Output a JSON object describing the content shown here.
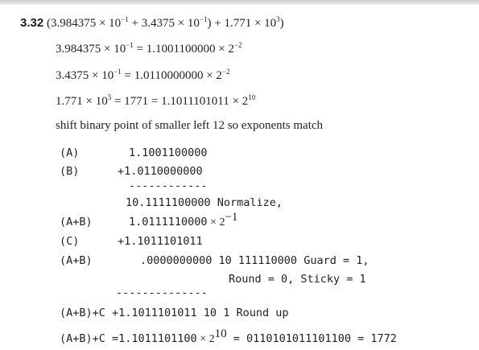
{
  "problem": {
    "number": "3.32",
    "expr": "(3.984375 × 10",
    "expr_e1": "−1",
    "expr_mid": " + 3.4375 × 10",
    "expr_e2": "−1",
    "expr_mid2": ") + 1.771 × 10",
    "expr_e3": "3",
    "expr_end": ")"
  },
  "conversions": [
    {
      "a": "3.984375 × 10",
      "ae": "−1",
      "b": " = 1.1001100000 × 2",
      "be": "−2"
    },
    {
      "a": "3.4375 × 10",
      "ae": "−1",
      "b": " = 1.0110000000 × 2",
      "be": "−2"
    },
    {
      "a": "1.771 × 10",
      "ae": "3",
      "b": " = 1771 = 1.1011101011 × 2",
      "be": "10"
    }
  ],
  "shift_note": "shift binary point of smaller left 12 so exponents match",
  "work": {
    "a_label": "(A)",
    "a_value": "1.1001100000",
    "b_label": "(B)",
    "b_value": "+1.0110000000",
    "sep1": "------------",
    "sum1": "10.1111100000 Normalize,",
    "apb_label": "(A+B)",
    "apb_value": "1.0111110000",
    "apb_exp_pre": " × 2",
    "apb_exp": "−1",
    "c_label": "(C)",
    "c_value": "+1.1011101011",
    "apb2_label": "(A+B)",
    "apb2_value": ".0000000000 10 111110000 Guard = 1,",
    "round_line": "Round = 0, Sticky = 1",
    "sep2": "--------------",
    "r1": "(A+B)+C +1.1011101011 10 1 Round up",
    "r2_pre": "(A+B)+C =1.1011101100",
    "r2_mid": " × 2",
    "r2_exp": "10",
    "r2_post": " = 0110101011101100 = 1772"
  }
}
